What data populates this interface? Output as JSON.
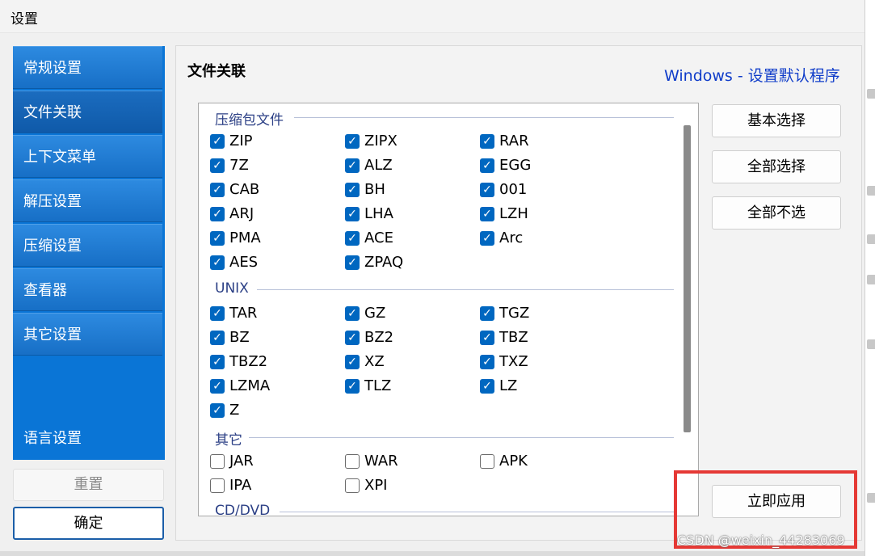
{
  "window": {
    "title": "设置"
  },
  "sidebar": {
    "items": [
      {
        "label": "常规设置",
        "active": false
      },
      {
        "label": "文件关联",
        "active": true
      },
      {
        "label": "上下文菜单",
        "active": false
      },
      {
        "label": "解压设置",
        "active": false
      },
      {
        "label": "压缩设置",
        "active": false
      },
      {
        "label": "查看器",
        "active": false
      },
      {
        "label": "其它设置",
        "active": false
      }
    ],
    "language_label": "语言设置",
    "reset_label": "重置",
    "ok_label": "确定"
  },
  "main": {
    "section_title": "文件关联",
    "windows_link": "Windows - 设置默认程序",
    "buttons": {
      "basic_select": "基本选择",
      "select_all": "全部选择",
      "select_none": "全部不选",
      "apply_now": "立即应用"
    },
    "groups": [
      {
        "name": "压缩包文件",
        "items": [
          {
            "label": "ZIP",
            "checked": true
          },
          {
            "label": "ZIPX",
            "checked": true
          },
          {
            "label": "RAR",
            "checked": true
          },
          {
            "label": "7Z",
            "checked": true
          },
          {
            "label": "ALZ",
            "checked": true
          },
          {
            "label": "EGG",
            "checked": true
          },
          {
            "label": "CAB",
            "checked": true
          },
          {
            "label": "BH",
            "checked": true
          },
          {
            "label": "001",
            "checked": true
          },
          {
            "label": "ARJ",
            "checked": true
          },
          {
            "label": "LHA",
            "checked": true
          },
          {
            "label": "LZH",
            "checked": true
          },
          {
            "label": "PMA",
            "checked": true
          },
          {
            "label": "ACE",
            "checked": true
          },
          {
            "label": "Arc",
            "checked": true
          },
          {
            "label": "AES",
            "checked": true
          },
          {
            "label": "ZPAQ",
            "checked": true
          }
        ]
      },
      {
        "name": "UNIX",
        "items": [
          {
            "label": "TAR",
            "checked": true
          },
          {
            "label": "GZ",
            "checked": true
          },
          {
            "label": "TGZ",
            "checked": true
          },
          {
            "label": "BZ",
            "checked": true
          },
          {
            "label": "BZ2",
            "checked": true
          },
          {
            "label": "TBZ",
            "checked": true
          },
          {
            "label": "TBZ2",
            "checked": true
          },
          {
            "label": "XZ",
            "checked": true
          },
          {
            "label": "TXZ",
            "checked": true
          },
          {
            "label": "LZMA",
            "checked": true
          },
          {
            "label": "TLZ",
            "checked": true
          },
          {
            "label": "LZ",
            "checked": true
          },
          {
            "label": "Z",
            "checked": true
          }
        ]
      },
      {
        "name": "其它",
        "items": [
          {
            "label": "JAR",
            "checked": false
          },
          {
            "label": "WAR",
            "checked": false
          },
          {
            "label": "APK",
            "checked": false
          },
          {
            "label": "IPA",
            "checked": false
          },
          {
            "label": "XPI",
            "checked": false
          }
        ]
      },
      {
        "name": "CD/DVD",
        "items": []
      }
    ]
  },
  "watermark": "CSDN @weixin_44283069",
  "colors": {
    "sidebar": "#0a75d6",
    "checkbox": "#0067c0",
    "link": "#0f3cc9",
    "highlight": "#e53935"
  }
}
